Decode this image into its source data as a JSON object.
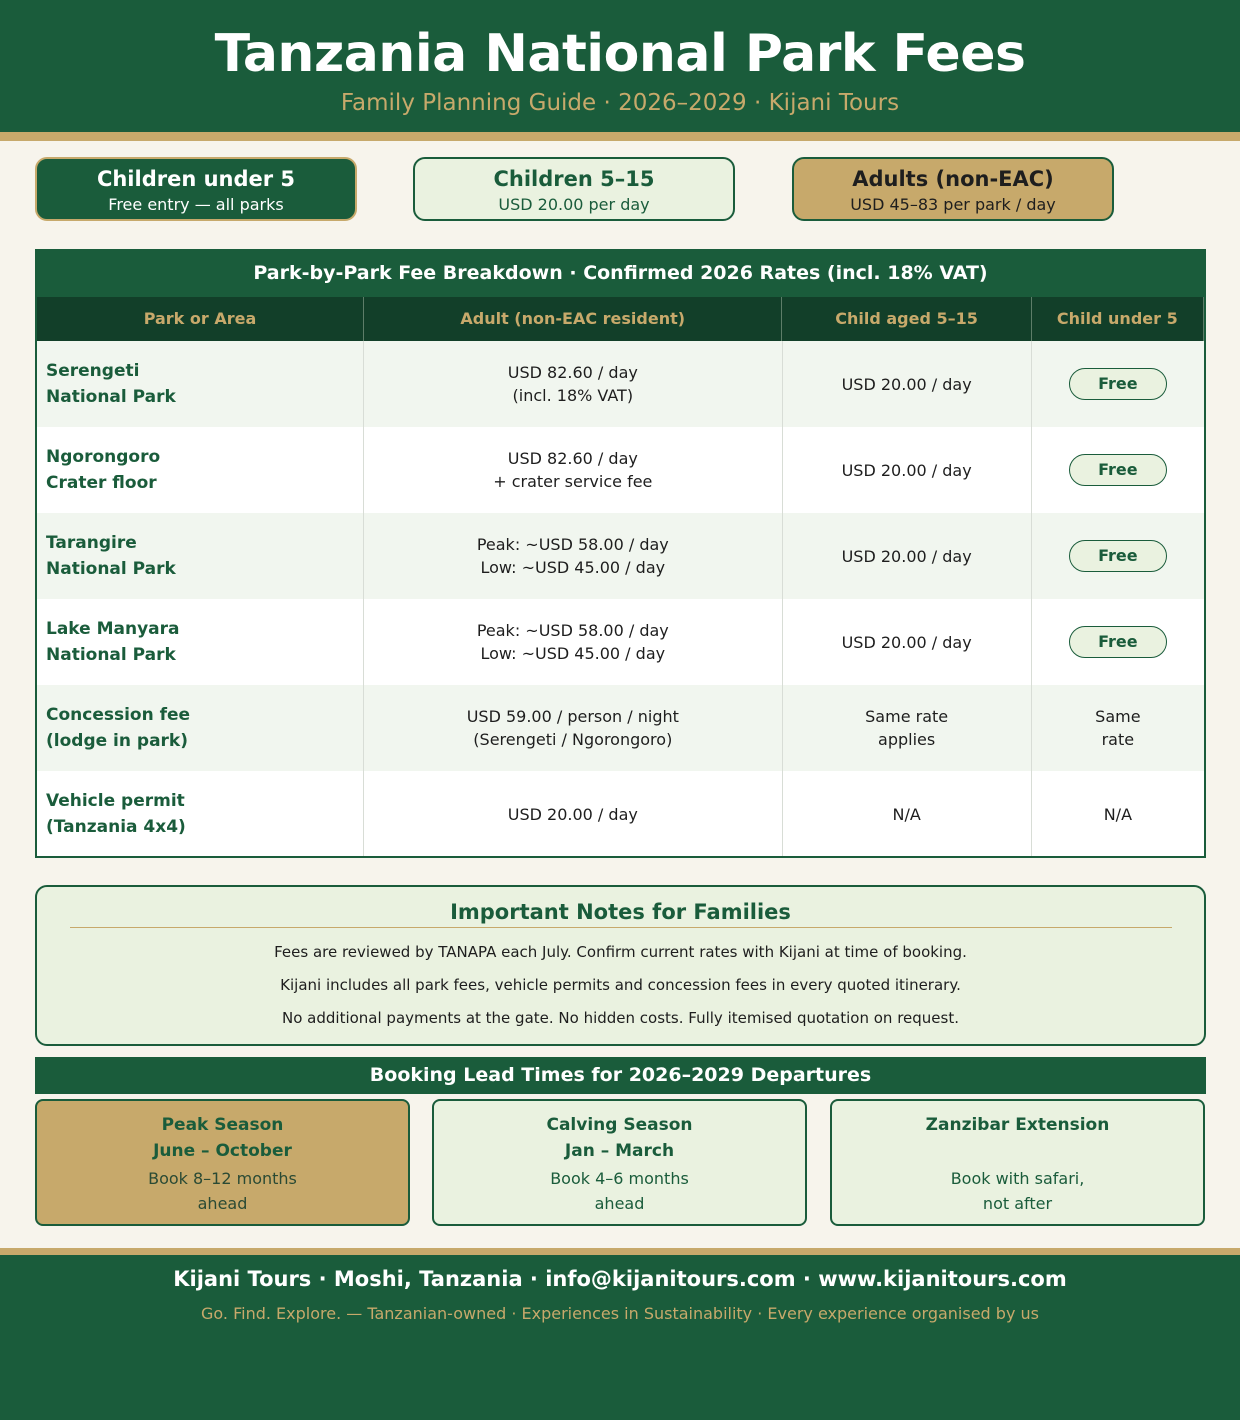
{
  "header": {
    "title": "Tanzania National Park Fees",
    "subtitle": "Family Planning Guide  ·  2026–2029  ·  Kijani Tours"
  },
  "pills": [
    {
      "title": "Children under 5",
      "sub": "Free entry — all parks"
    },
    {
      "title": "Children 5–15",
      "sub": "USD 20.00 per day"
    },
    {
      "title": "Adults (non-EAC)",
      "sub": "USD 45–83 per park / day"
    }
  ],
  "table": {
    "title": "Park-by-Park Fee Breakdown  ·  Confirmed 2026 Rates (incl. 18% VAT)",
    "headers": [
      "Park or Area",
      "Adult (non-EAC resident)",
      "Child aged 5–15",
      "Child under 5"
    ],
    "rows": [
      {
        "park": [
          "Serengeti",
          "National Park"
        ],
        "adult": [
          "USD 82.60 / day",
          "(incl. 18% VAT)"
        ],
        "child": [
          "USD 20.00 / day"
        ],
        "under5": "Free"
      },
      {
        "park": [
          "Ngorongoro",
          "Crater floor"
        ],
        "adult": [
          "USD 82.60 / day",
          "+ crater service fee"
        ],
        "child": [
          "USD 20.00 / day"
        ],
        "under5": "Free"
      },
      {
        "park": [
          "Tarangire",
          "National Park"
        ],
        "adult": [
          "Peak: ~USD 58.00 / day",
          "Low: ~USD 45.00 / day"
        ],
        "child": [
          "USD 20.00 / day"
        ],
        "under5": "Free"
      },
      {
        "park": [
          "Lake Manyara",
          "National Park"
        ],
        "adult": [
          "Peak: ~USD 58.00 / day",
          "Low: ~USD 45.00 / day"
        ],
        "child": [
          "USD 20.00 / day"
        ],
        "under5": "Free"
      },
      {
        "park": [
          "Concession fee",
          "(lodge in park)"
        ],
        "adult": [
          "USD 59.00 / person / night",
          "(Serengeti / Ngorongoro)"
        ],
        "child": [
          "Same rate",
          "applies"
        ],
        "under5": [
          "Same",
          "rate"
        ]
      },
      {
        "park": [
          "Vehicle permit",
          "(Tanzania 4x4)"
        ],
        "adult": [
          "USD 20.00 / day"
        ],
        "child": [
          "N/A"
        ],
        "under5": [
          "N/A"
        ]
      }
    ]
  },
  "notes": {
    "title": "Important Notes for Families",
    "lines": [
      "Fees are reviewed by TANAPA each July. Confirm current rates with Kijani at time of booking.",
      "Kijani includes all park fees, vehicle permits and concession fees in every quoted itinerary.",
      "No additional payments at the gate. No hidden costs. Fully itemised quotation on request."
    ]
  },
  "lead": {
    "title": "Booking Lead Times for 2026–2029 Departures",
    "cards": [
      {
        "h1": "Peak Season",
        "h2": "June – October",
        "b1": "Book 8–12 months",
        "b2": "ahead"
      },
      {
        "h1": "Calving Season",
        "h2": "Jan – March",
        "b1": "Book 4–6 months",
        "b2": "ahead"
      },
      {
        "h1": "Zanzibar Extension",
        "h2": "",
        "b1": "Book with safari,",
        "b2": "not after"
      }
    ]
  },
  "footer": {
    "line1": "Kijani Tours  ·  Moshi, Tanzania  ·  info@kijanitours.com  ·  www.kijanitours.com",
    "line2": "Go. Find. Explore.  —  Tanzanian-owned  ·  Experiences in Sustainability  ·  Every experience organised by us"
  },
  "colors": {
    "primary": "#1a5c3b",
    "gold": "#c7a96b",
    "light": "#eaf2e0",
    "cream": "#f7f4ec"
  }
}
